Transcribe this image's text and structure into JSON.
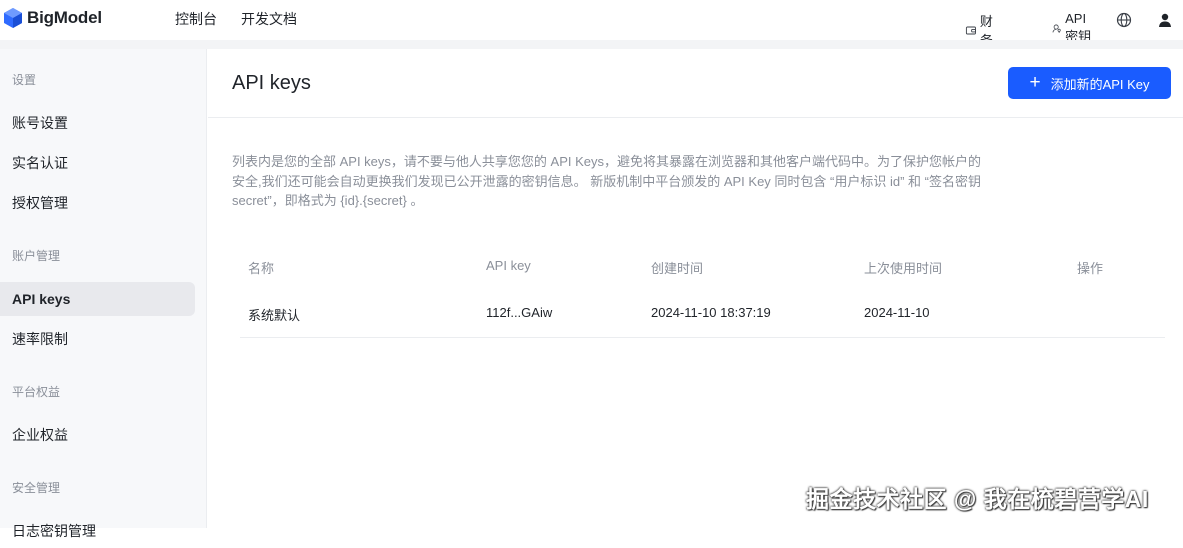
{
  "app": {
    "name": "BigModel",
    "logo_icon": "bigmodel-logo-icon",
    "accent_color": "#1a5cff"
  },
  "topnav": {
    "items": [
      {
        "label": "控制台"
      },
      {
        "label": "开发文档"
      }
    ],
    "right": {
      "finance_label": "财务",
      "api_key_label": "API密钥",
      "globe_icon": "globe-icon",
      "user_icon": "user-icon"
    }
  },
  "sidebar": {
    "group_settings": "设置",
    "account_settings": "账号设置",
    "real_name": "实名认证",
    "auth_management": "授权管理",
    "group_account": "账户管理",
    "api_keys": "API keys",
    "rate_limit": "速率限制",
    "group_platform": "平台权益",
    "enterprise_rights": "企业权益",
    "group_security": "安全管理",
    "partial_item": "日志密钥管理"
  },
  "main": {
    "title": "API keys",
    "add_button": "添加新的API Key",
    "description": "列表内是您的全部 API keys，请不要与他人共享您您的 API Keys，避免将其暴露在浏览器和其他客户端代码中。为了保护您帐户的安全,我们还可能会自动更换我们发现已公开泄露的密钥信息。 新版机制中平台颁发的 API Key 同时包含 “用户标识 id” 和 “签名密钥 secret”，即格式为 {id}.{secret} 。",
    "table": {
      "headers": {
        "name": "名称",
        "api_key": "API key",
        "created": "创建时间",
        "last_used": "上次使用时间",
        "actions": "操作"
      },
      "rows": [
        {
          "name": "系统默认",
          "api_key": "112f...GAiw",
          "created": "2024-11-10 18:37:19",
          "last_used": "2024-11-10",
          "actions": ""
        }
      ]
    }
  },
  "watermark": "掘金技术社区 @ 我在梳碧营学AI"
}
